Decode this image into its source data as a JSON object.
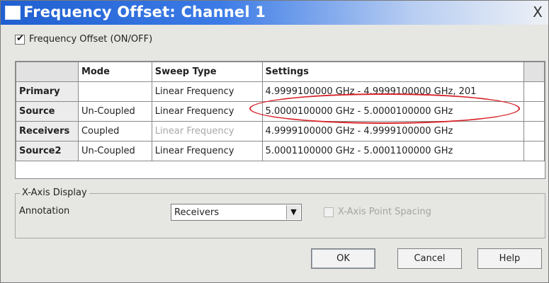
{
  "window": {
    "title": "Frequency Offset: Channel 1",
    "close_glyph": "X"
  },
  "toggle": {
    "label": "Frequency Offset (ON/OFF)",
    "checked": true
  },
  "table": {
    "headers": [
      "",
      "Mode",
      "Sweep Type",
      "Settings"
    ],
    "rows": [
      {
        "name": "Primary",
        "mode": "",
        "sweep": "Linear Frequency",
        "settings": "4.9999100000 GHz - 4.9999100000 GHz, 201",
        "sweep_disabled": false
      },
      {
        "name": "Source",
        "mode": "Un-Coupled",
        "sweep": "Linear Frequency",
        "settings": "5.0000100000 GHz - 5.0000100000 GHz",
        "sweep_disabled": false
      },
      {
        "name": "Receivers",
        "mode": "Coupled",
        "sweep": "Linear Frequency",
        "settings": "4.9999100000 GHz - 4.9999100000 GHz",
        "sweep_disabled": true
      },
      {
        "name": "Source2",
        "mode": "Un-Coupled",
        "sweep": "Linear Frequency",
        "settings": "5.0001100000 GHz - 5.0001100000 GHz",
        "sweep_disabled": false
      }
    ],
    "highlight_color": "#d8262b"
  },
  "xaxis": {
    "group_label": "X-Axis Display",
    "annotation_label": "Annotation",
    "annotation_value": "Receivers",
    "point_spacing_label": "X-Axis Point Spacing",
    "point_spacing_checked": false
  },
  "buttons": {
    "ok": "OK",
    "cancel": "Cancel",
    "help": "Help"
  },
  "colors": {
    "titlebar": "#1f5fd0",
    "dialog_bg": "#e6e6e2"
  }
}
